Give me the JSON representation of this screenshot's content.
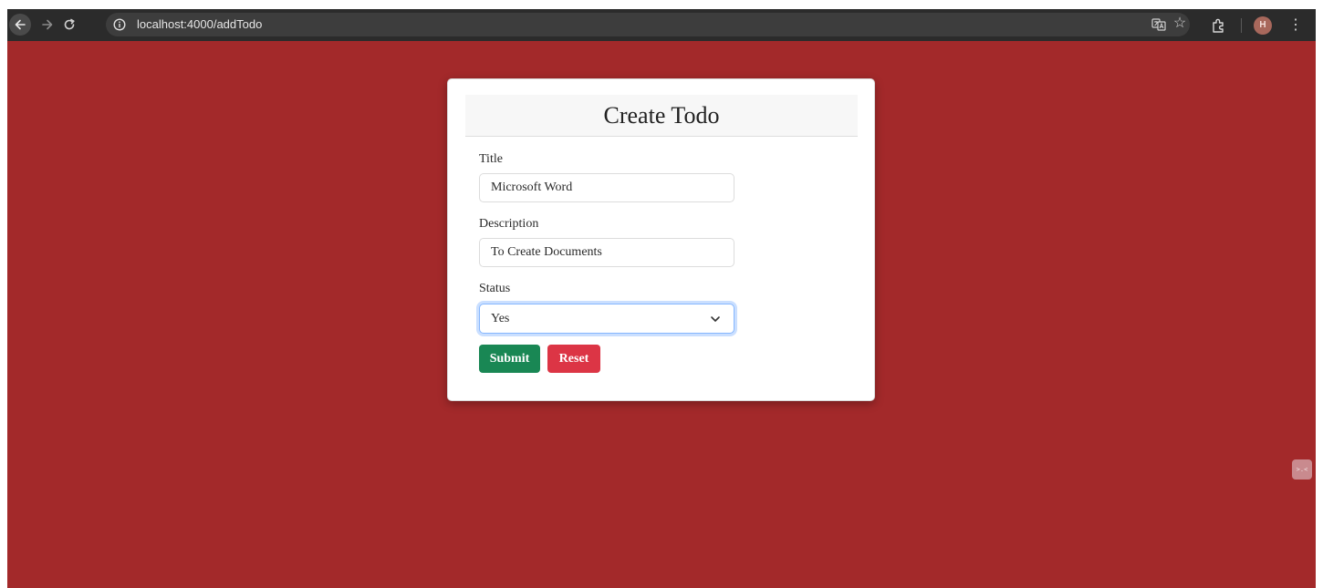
{
  "browser": {
    "url": "localhost:4000/addTodo",
    "profile_initial": "H",
    "toolbar_icons": [
      "back-arrow-icon",
      "forward-arrow-icon",
      "reload-icon",
      "site-info-icon",
      "translate-icon",
      "bookmark-star-icon",
      "extensions-icon",
      "menu-icon"
    ]
  },
  "page": {
    "background_color": "#a3292a"
  },
  "form": {
    "heading": "Create Todo",
    "title_label": "Title",
    "title_value": "Microsoft Word",
    "description_label": "Description",
    "description_value": "To Create Documents",
    "status_label": "Status",
    "status_selected": "Yes",
    "submit_label": "Submit",
    "submit_color": "#198754",
    "reset_label": "Reset",
    "reset_color": "#dc3545"
  },
  "widget": {
    "icon": "code-brackets-icon",
    "glyph": ">.<"
  }
}
